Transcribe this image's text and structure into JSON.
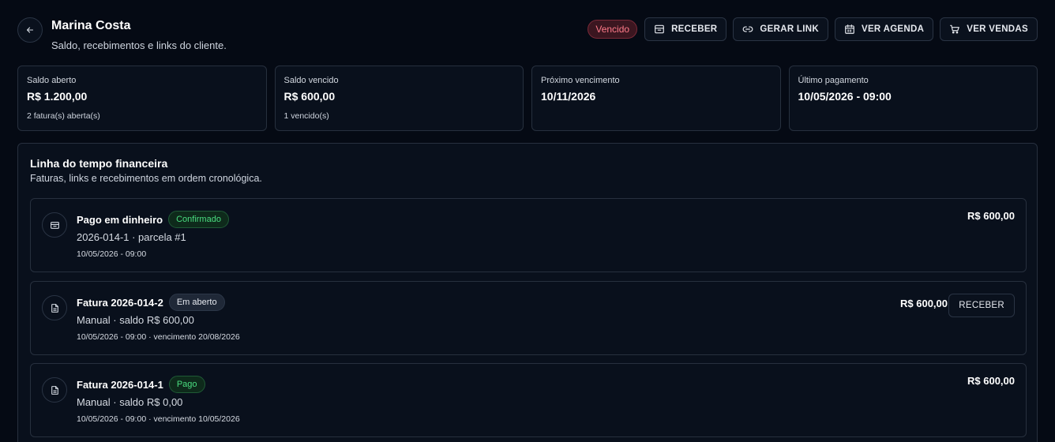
{
  "header": {
    "title": "Marina Costa",
    "subtitle": "Saldo, recebimentos e links do cliente.",
    "status_badge": "Vencido",
    "actions": {
      "receber": "RECEBER",
      "gerar_link": "GERAR LINK",
      "ver_agenda": "VER AGENDA",
      "ver_vendas": "VER VENDAS"
    }
  },
  "summary": [
    {
      "label": "Saldo aberto",
      "value": "R$ 1.200,00",
      "note": "2 fatura(s) aberta(s)"
    },
    {
      "label": "Saldo vencido",
      "value": "R$ 600,00",
      "note": "1 vencido(s)"
    },
    {
      "label": "Próximo vencimento",
      "value": "10/11/2026",
      "note": ""
    },
    {
      "label": "Último pagamento",
      "value": "10/05/2026 - 09:00",
      "note": ""
    }
  ],
  "timeline": {
    "title": "Linha do tempo financeira",
    "subtitle": "Faturas, links e recebimentos em ordem cronológica.",
    "entries": [
      {
        "title": "Pago em dinheiro",
        "status": "Confirmado",
        "line": "2026-014-1 · parcela #1",
        "meta": "10/05/2026 - 09:00",
        "amount": "R$ 600,00",
        "icon": "cash-icon"
      },
      {
        "title": "Fatura 2026-014-2",
        "status": "Em aberto",
        "line": "Manual · saldo R$ 600,00",
        "meta": "10/05/2026 - 09:00 · vencimento 20/08/2026",
        "amount": "R$ 600,00",
        "action": "RECEBER",
        "icon": "document-icon"
      },
      {
        "title": "Fatura 2026-014-1",
        "status": "Pago",
        "line": "Manual · saldo R$ 0,00",
        "meta": "10/05/2026 - 09:00 · vencimento 10/05/2026",
        "amount": "R$ 600,00",
        "icon": "document-icon"
      }
    ]
  },
  "colors": {
    "background": "#050a14",
    "danger": "#ff7b8a",
    "success": "#4ade80"
  }
}
